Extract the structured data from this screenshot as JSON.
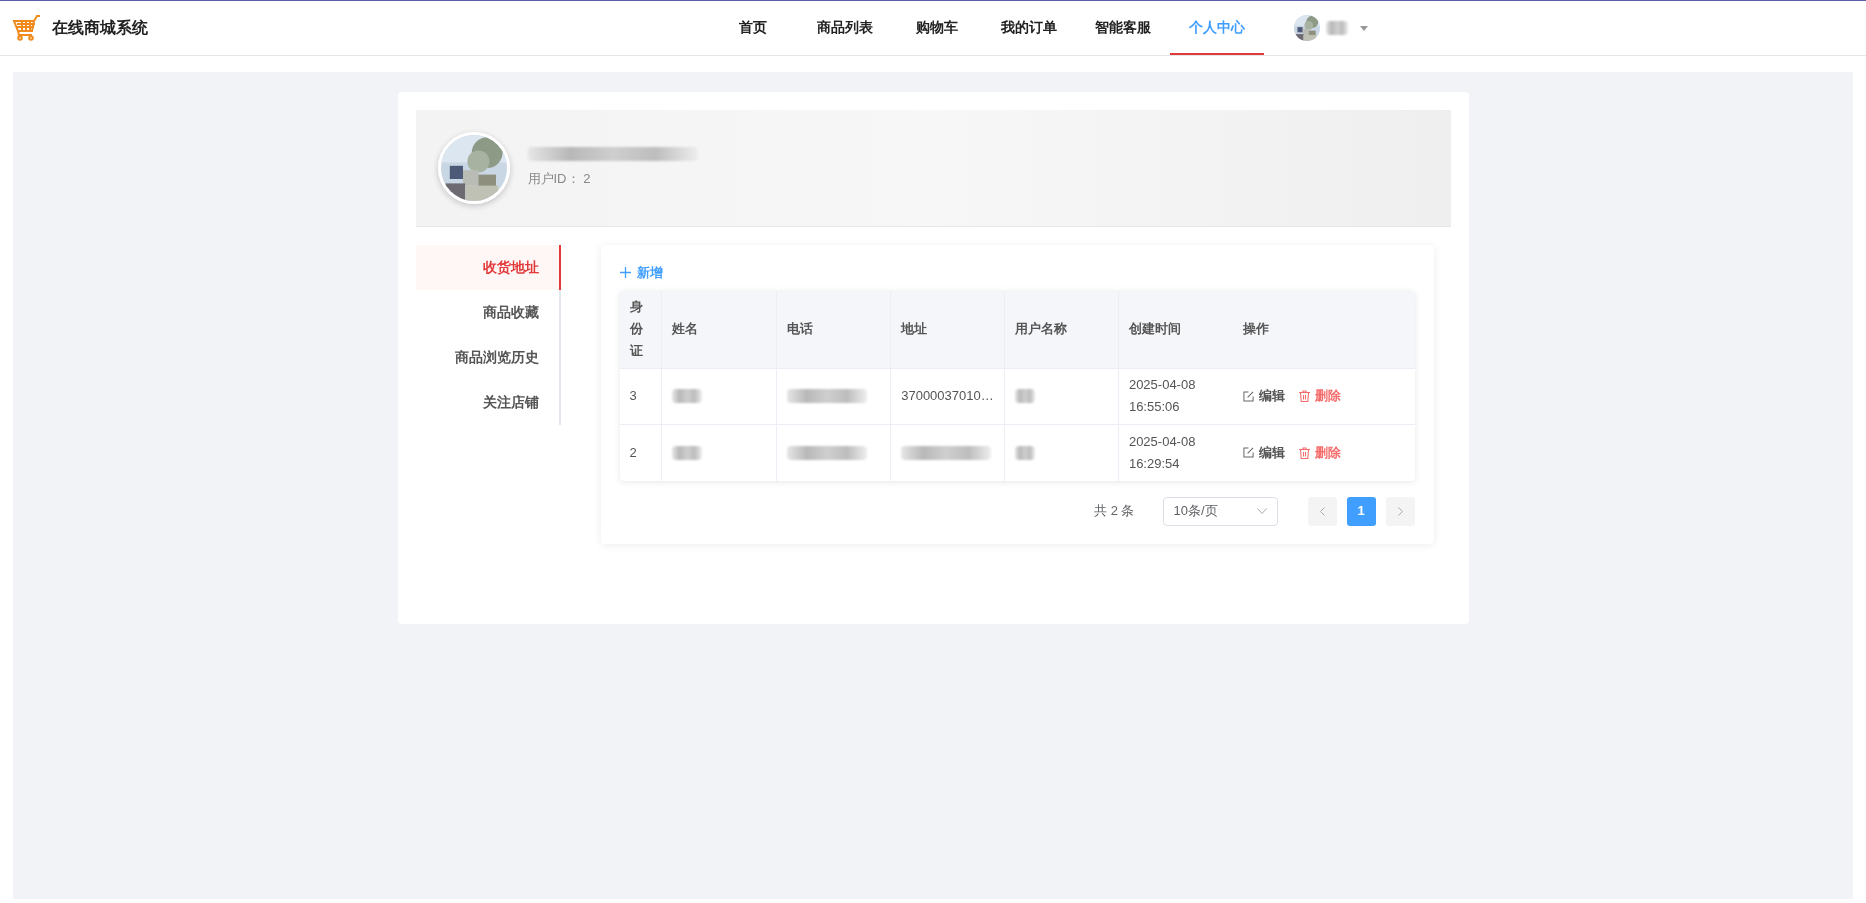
{
  "header": {
    "logo_text": "在线商城系统",
    "nav": [
      {
        "label": "首页",
        "selected": false
      },
      {
        "label": "商品列表",
        "selected": false
      },
      {
        "label": "购物车",
        "selected": false
      },
      {
        "label": "我的订单",
        "selected": false
      },
      {
        "label": "智能客服",
        "selected": false
      },
      {
        "label": "个人中心",
        "selected": true
      }
    ],
    "user": {
      "name": {
        "kind": "redacted"
      }
    }
  },
  "profile": {
    "name": {
      "kind": "redacted"
    },
    "id_label": "用户ID：",
    "id_value": "2"
  },
  "sidebar": {
    "items": [
      {
        "label": "收货地址",
        "selected": true
      },
      {
        "label": "商品收藏",
        "selected": false
      },
      {
        "label": "商品浏览历史",
        "selected": false
      },
      {
        "label": "关注店铺",
        "selected": false
      }
    ]
  },
  "toolbar": {
    "add_button": "新增"
  },
  "table": {
    "columns": [
      "身份证",
      "姓名",
      "电话",
      "地址",
      "用户名称",
      "创建时间",
      "操作"
    ],
    "rows": [
      {
        "cells": [
          {
            "kind": "text",
            "text": "3"
          },
          {
            "kind": "redacted"
          },
          {
            "kind": "redacted"
          },
          {
            "kind": "text",
            "text": "37000037010…"
          },
          {
            "kind": "redacted"
          },
          {
            "kind": "datetime",
            "date": "2025-04-08",
            "time": "16:55:06"
          }
        ],
        "actions": [
          "编辑",
          "删除"
        ]
      },
      {
        "cells": [
          {
            "kind": "text",
            "text": "2"
          },
          {
            "kind": "redacted"
          },
          {
            "kind": "redacted"
          },
          {
            "kind": "redacted"
          },
          {
            "kind": "redacted"
          },
          {
            "kind": "datetime",
            "date": "2025-04-08",
            "time": "16:29:54"
          }
        ],
        "actions": [
          "编辑",
          "删除"
        ]
      }
    ]
  },
  "pagination": {
    "total": "共 2 条",
    "page_size": "10条/页",
    "pages": [
      {
        "label": "1",
        "selected": true
      }
    ]
  }
}
